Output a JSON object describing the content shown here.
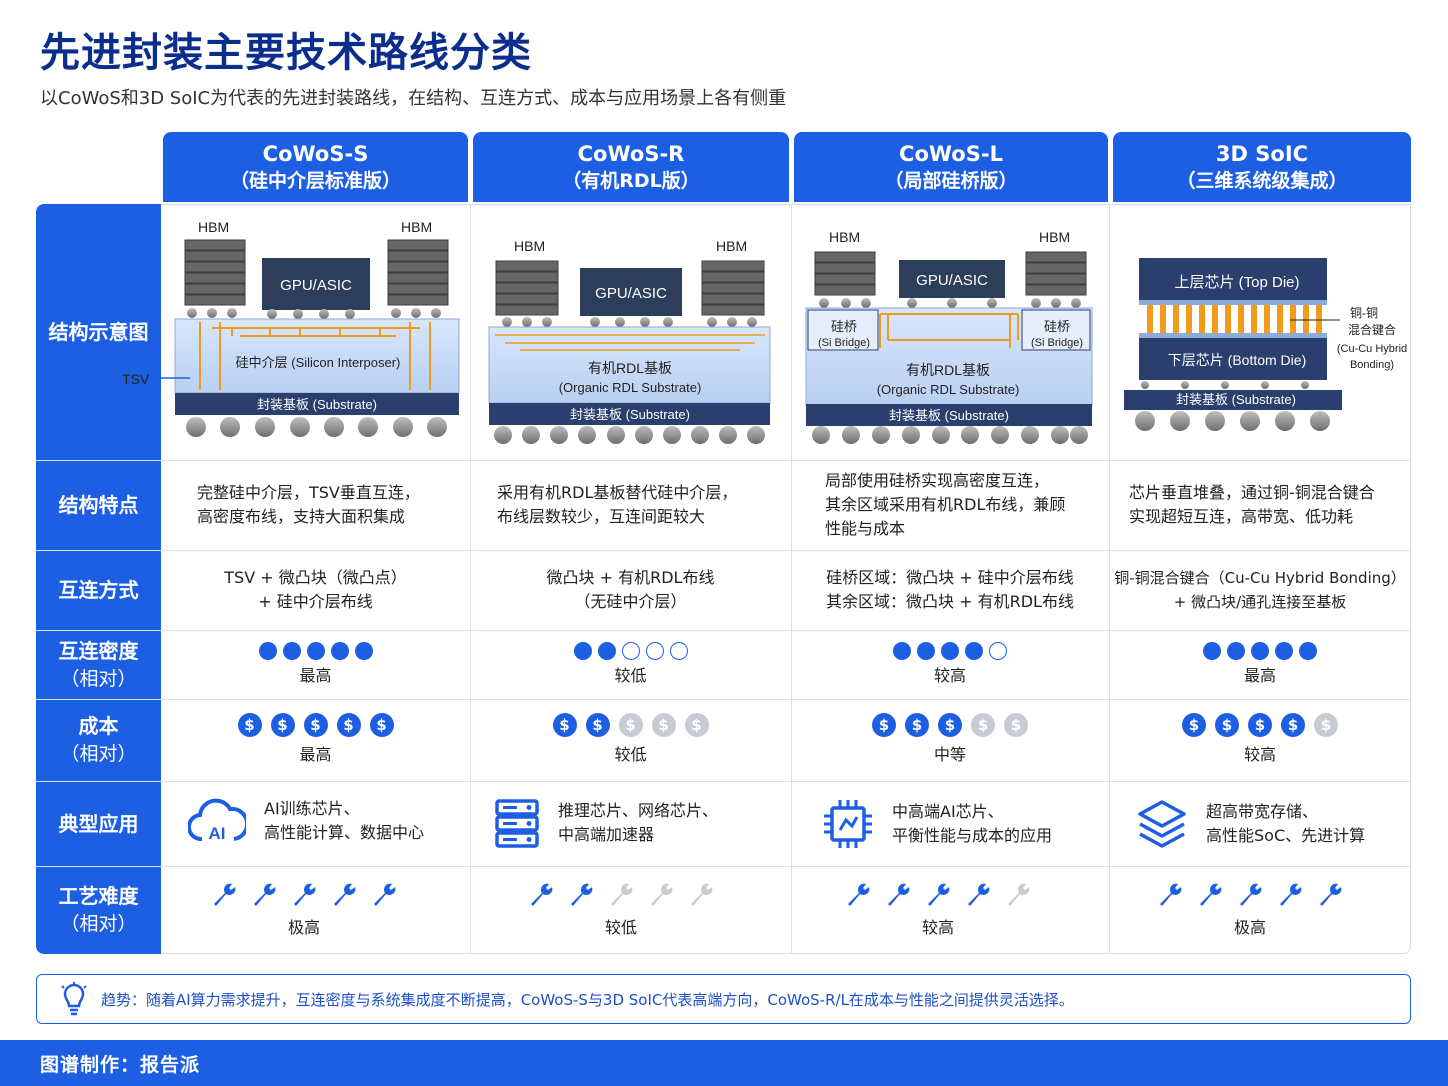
{
  "title": "先进封装主要技术路线分类",
  "subtitle": "以CoWoS和3D SoIC为代表的先进封装路线，在结构、互连方式、成本与应用场景上各有侧重",
  "row_labels": {
    "diagram": "结构示意图",
    "features": "结构特点",
    "interconnect": "互连方式",
    "density": "互连密度",
    "density_sub": "（相对）",
    "cost": "成本",
    "cost_sub": "（相对）",
    "apps": "典型应用",
    "difficulty": "工艺难度",
    "difficulty_sub": "（相对）"
  },
  "columns": [
    {
      "name": "CoWoS-S",
      "sub": "（硅中介层标准版）",
      "features": [
        "完整硅中介层，TSV垂直互连，",
        "高密度布线，支持大面积集成"
      ],
      "interconnect": [
        "TSV + 微凸块（微凸点）",
        "+ 硅中介层布线"
      ],
      "density": 5,
      "density_label": "最高",
      "cost": 5,
      "cost_label": "最高",
      "apps": [
        "AI训练芯片、",
        "高性能计算、数据中心"
      ],
      "app_icon": "ai-cloud-icon",
      "difficulty": 5,
      "difficulty_label": "极高"
    },
    {
      "name": "CoWoS-R",
      "sub": "（有机RDL版）",
      "features": [
        "采用有机RDL基板替代硅中介层，",
        "布线层数较少，互连间距较大"
      ],
      "interconnect": [
        "微凸块 + 有机RDL布线",
        "（无硅中介层）"
      ],
      "density": 2,
      "density_label": "较低",
      "cost": 2,
      "cost_label": "较低",
      "apps": [
        "推理芯片、网络芯片、",
        "中高端加速器"
      ],
      "app_icon": "server-icon",
      "difficulty": 2,
      "difficulty_label": "较低"
    },
    {
      "name": "CoWoS-L",
      "sub": "（局部硅桥版）",
      "features": [
        "局部使用硅桥实现高密度互连，",
        "其余区域采用有机RDL布线，兼顾",
        "性能与成本"
      ],
      "interconnect": [
        "硅桥区域：微凸块 + 硅中介层布线",
        "其余区域：微凸块 + 有机RDL布线"
      ],
      "density": 4,
      "density_label": "较高",
      "cost": 3,
      "cost_label": "中等",
      "apps": [
        "中高端AI芯片、",
        "平衡性能与成本的应用"
      ],
      "app_icon": "chip-icon",
      "difficulty": 4,
      "difficulty_label": "较高"
    },
    {
      "name": "3D SoIC",
      "sub": "（三维系统级集成）",
      "features": [
        "芯片垂直堆叠，通过铜-铜混合键合",
        "实现超短互连，高带宽、低功耗"
      ],
      "interconnect": [
        "铜-铜混合键合（Cu-Cu Hybrid Bonding）",
        "+ 微凸块/通孔连接至基板"
      ],
      "density": 5,
      "density_label": "最高",
      "cost": 4,
      "cost_label": "较高",
      "apps": [
        "超高带宽存储、",
        "高性能SoC、先进计算"
      ],
      "app_icon": "layers-icon",
      "difficulty": 5,
      "difficulty_label": "极高"
    }
  ],
  "diagram_labels": {
    "hbm": "HBM",
    "gpu": "GPU/ASIC",
    "tsv": "TSV",
    "si_interposer": "硅中介层 (Silicon Interposer)",
    "substrate": "封装基板 (Substrate)",
    "rdl": "有机RDL基板",
    "rdl_en": "(Organic RDL Substrate)",
    "bridge": "硅桥",
    "bridge_en": "(Si Bridge)",
    "top_die": "上层芯片 (Top Die)",
    "bottom_die": "下层芯片 (Bottom Die)",
    "cu_bond_1": "铜-铜",
    "cu_bond_2": "混合键合",
    "cu_bond_3": "(Cu-Cu Hybrid",
    "cu_bond_4": "Bonding)"
  },
  "trend": "趋势：随着AI算力需求提升，互连密度与系统集成度不断提高，CoWoS-S与3D SoIC代表高端方向，CoWoS-R/L在成本与性能之间提供灵活选择。",
  "footer": "图谱制作：报告派",
  "colors": {
    "primary": "#1d5fe3",
    "dark": "#0b2d8c",
    "grey": "#c6cbd4"
  }
}
